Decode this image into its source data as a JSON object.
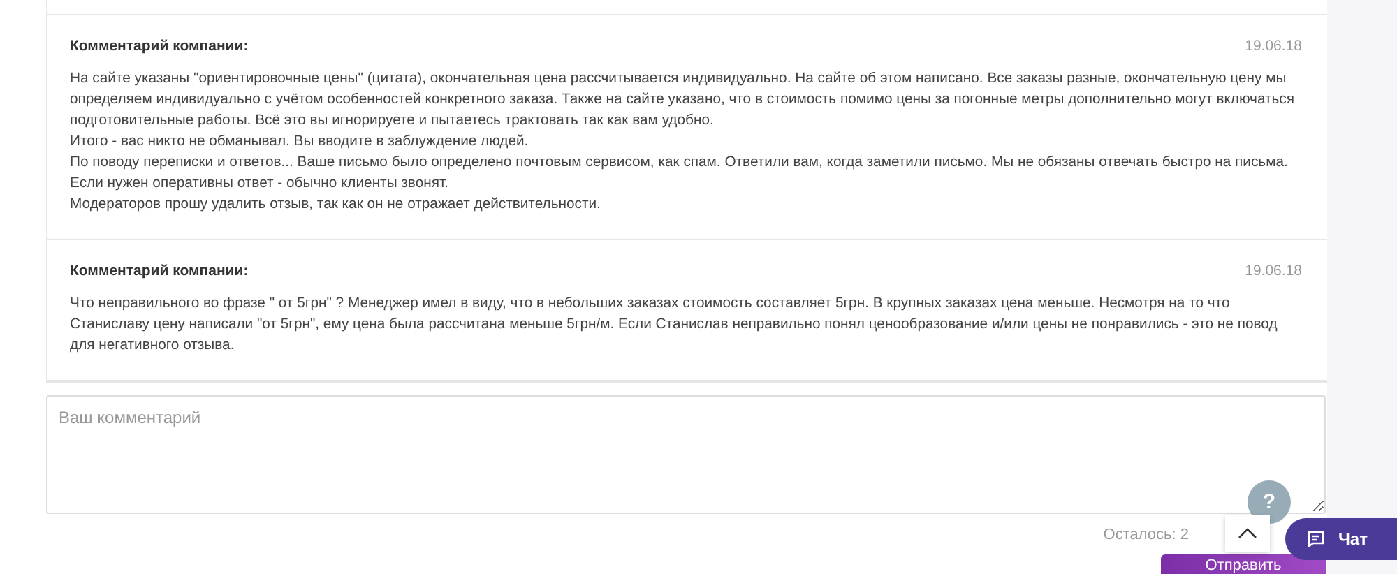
{
  "comments": [
    {
      "title": "Комментарий компании:",
      "date": "19.06.18",
      "paragraphs": [
        "На сайте указаны \"ориентировочные цены\" (цитата), окончательная цена рассчитывается индивидуально.  На сайте об этом написано. Все заказы разные, окончательную цену мы определяем индивидуально с учётом особенностей конкретного заказа. Также на сайте указано, что в стоимость помимо цены за погонные метры дополнительно могут включаться подготовительные работы. Всё это вы игнорируете и пытаетесь трактовать так как вам удобно.",
        "Итого - вас никто не обманывал. Вы вводите в заблуждение людей.",
        "По поводу переписки и ответов... Ваше письмо было определено почтовым сервисом, как спам. Ответили вам, когда заметили письмо. Мы не обязаны отвечать быстро на письма. Если нужен оперативны ответ - обычно клиенты звонят.",
        "Модераторов прошу удалить отзыв, так как он не отражает действительности."
      ]
    },
    {
      "title": "Комментарий компании:",
      "date": "19.06.18",
      "paragraphs": [
        "Что неправильного во фразе \" от 5грн\" ? Менеджер имел в виду, что в небольших заказах стоимость составляет 5грн. В крупных заказах цена меньше. Несмотря на то что Станиславу цену написали \"от 5грн\", ему цена была рассчитана меньше 5грн/м. Если Станислав неправильно понял ценообразование и/или цены не понравились - это не повод для негативного отзыва."
      ]
    }
  ],
  "comment_field": {
    "placeholder": "Ваш комментарий"
  },
  "counter": "Осталось: 2",
  "submit_button": "Отправить",
  "help_button": "?",
  "chat_button": "Чат"
}
